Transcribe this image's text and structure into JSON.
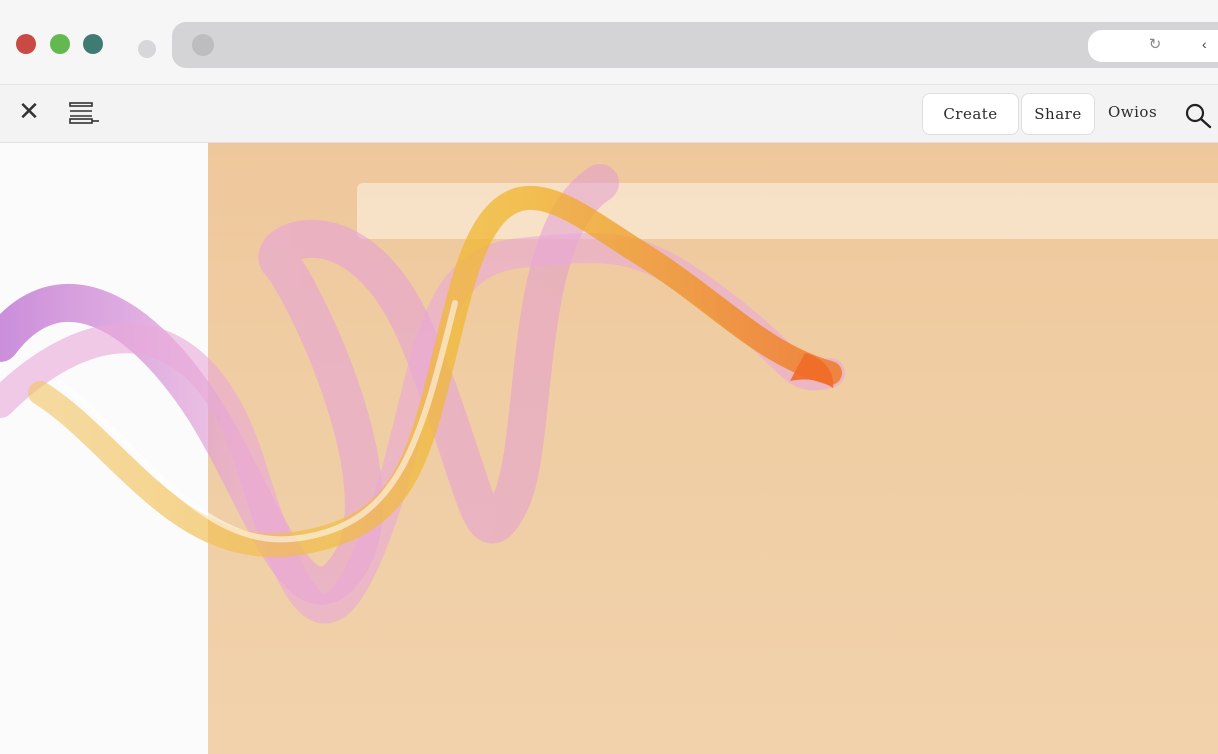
{
  "window": {
    "traffic_lights": [
      "close",
      "minimize",
      "zoom"
    ]
  },
  "address_bar": {
    "reload_icon": "reload-icon",
    "mark": "‹"
  },
  "toolbar": {
    "close_icon": "close-icon",
    "list_icon": "list-icon",
    "create_label": "Create",
    "share_label": "Share",
    "more_label": "Owios",
    "search_icon": "search-icon"
  },
  "colors": {
    "canvas_bg": "#efc79c",
    "ribbon_pink": "#e7a6d7",
    "ribbon_purple": "#b45bcc",
    "ribbon_yellow": "#f0b62e",
    "ribbon_orange": "#ef7b2a"
  }
}
